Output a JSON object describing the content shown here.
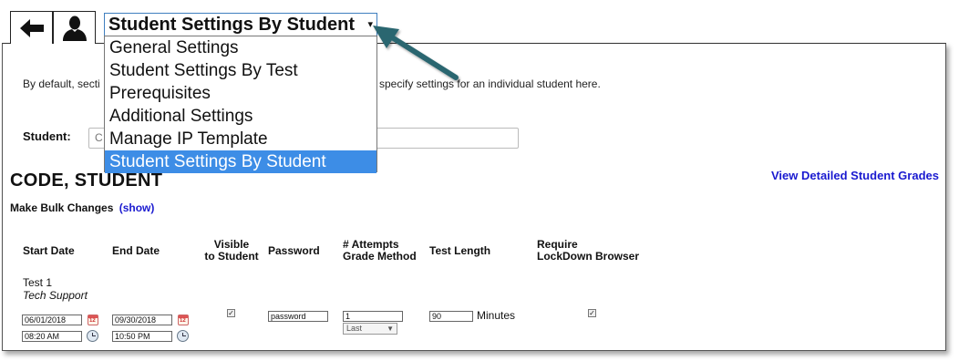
{
  "toolbar": {
    "back_icon": "arrow-left-icon",
    "user_icon": "user-icon"
  },
  "dropdown": {
    "selected": "Student Settings By Student",
    "arrow": "▾",
    "options": [
      "General Settings",
      "Student Settings By Test",
      "Prerequisites",
      "Additional Settings",
      "Manage IP Template",
      "Student Settings By Student"
    ]
  },
  "description": {
    "left": "By default, secti",
    "right": "specify settings for an individual student here."
  },
  "student_picker": {
    "label": "Student:",
    "value": "C"
  },
  "student": {
    "name": "CODE, STUDENT",
    "grades_link": "View Detailed Student Grades"
  },
  "bulk": {
    "label": "Make Bulk Changes",
    "show": "(show)"
  },
  "table": {
    "headers": {
      "start_date": "Start Date",
      "end_date": "End Date",
      "visible_1": "Visible",
      "visible_2": "to Student",
      "password": "Password",
      "attempts_1": "# Attempts",
      "attempts_2": "Grade Method",
      "test_length": "Test Length",
      "lockdown_1": "Require",
      "lockdown_2": "LockDown Browser"
    },
    "row": {
      "test_name": "Test 1",
      "test_group": "Tech Support",
      "start_date": "06/01/2018",
      "start_time": "08:20 AM",
      "end_date": "09/30/2018",
      "end_time": "10:50 PM",
      "visible_checked": true,
      "password": "password",
      "attempts": "1",
      "grade_method": "Last",
      "test_length": "90",
      "test_length_unit": "Minutes",
      "lockdown_checked": true
    }
  },
  "colors": {
    "link": "#1a1ad0",
    "selected_option": "#3d8de6",
    "pointer_arrow": "#2a6670"
  }
}
